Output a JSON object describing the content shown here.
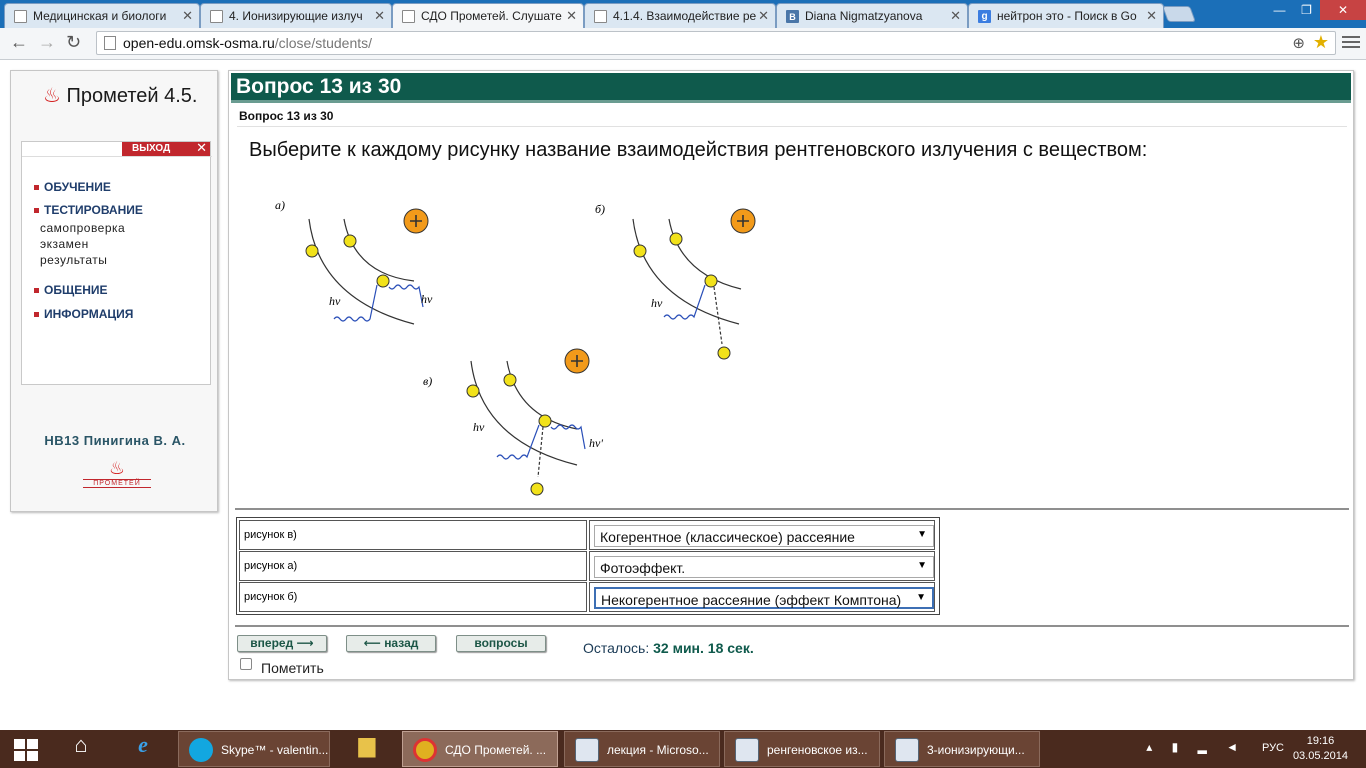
{
  "browser": {
    "tabs": [
      {
        "label": "Медицинская и биологи",
        "icon": "doc-icon",
        "active": false
      },
      {
        "label": "4. Ионизирующие излуч",
        "icon": "doc-icon",
        "active": false
      },
      {
        "label": "СДО Прометей. Слушате",
        "icon": "doc-icon",
        "active": true
      },
      {
        "label": "4.1.4. Взаимодействие ре",
        "icon": "doc-icon",
        "active": false
      },
      {
        "label": "Diana Nigmatzyanova",
        "icon": "vk-icon",
        "active": false
      },
      {
        "label": "нейтрон это - Поиск в Go",
        "icon": "google-icon",
        "active": false
      }
    ],
    "url_host": "open-edu.omsk-osma.ru",
    "url_path": "/close/students/"
  },
  "sidebar": {
    "logo": "Прометей 4.5.",
    "exit_label": "ВЫХОД",
    "menu": [
      {
        "label": "ОБУЧЕНИЕ"
      },
      {
        "label": "ТЕСТИРОВАНИЕ"
      },
      {
        "label": "ОБЩЕНИЕ"
      },
      {
        "label": "ИНФОРМАЦИЯ"
      }
    ],
    "submenu": [
      "самопроверка",
      "экзамен",
      "результаты"
    ],
    "user": "НВ13 Пинигина В. А.",
    "small_logo": "ПРОМЕТЕЙ"
  },
  "question": {
    "header": "Вопрос 13 из 30",
    "subheader": "Вопрос 13 из 30",
    "text": "Выберите к каждому рисунку название взаимодействия рентгеновского излучения с веществом:",
    "figure_labels": {
      "a": "а)",
      "b": "б)",
      "c": "в)",
      "hv": "hν",
      "hv_prime": "hν'"
    },
    "answers": [
      {
        "label": "рисунок в)",
        "selected": "Когерентное (классическое) рассеяние"
      },
      {
        "label": "рисунок а)",
        "selected": "Фотоэффект."
      },
      {
        "label": "рисунок б)",
        "selected": "Некогерентное рассеяние (эффект Комптона)"
      }
    ]
  },
  "footer": {
    "forward": "вперед",
    "back": "назад",
    "questions": "вопросы",
    "timer_label": "Осталось:",
    "timer_value": "32 мин. 18 сек.",
    "mark_label": "Пометить"
  },
  "taskbar": {
    "items": [
      {
        "label": "Skype™ - valentin..."
      },
      {
        "label": "СДО Прометей. ..."
      },
      {
        "label": "лекция - Microso..."
      },
      {
        "label": "ренгеновское из..."
      },
      {
        "label": "3-ионизирующи..."
      }
    ],
    "lang": "РУС",
    "time": "19:16",
    "date": "03.05.2014"
  },
  "colors": {
    "header_green": "#0f5a4c",
    "accent_red": "#c1272d",
    "nucleus_orange": "#f29a1a",
    "electron_yellow": "#f2e21a",
    "photon_blue": "#2a4fb8"
  }
}
